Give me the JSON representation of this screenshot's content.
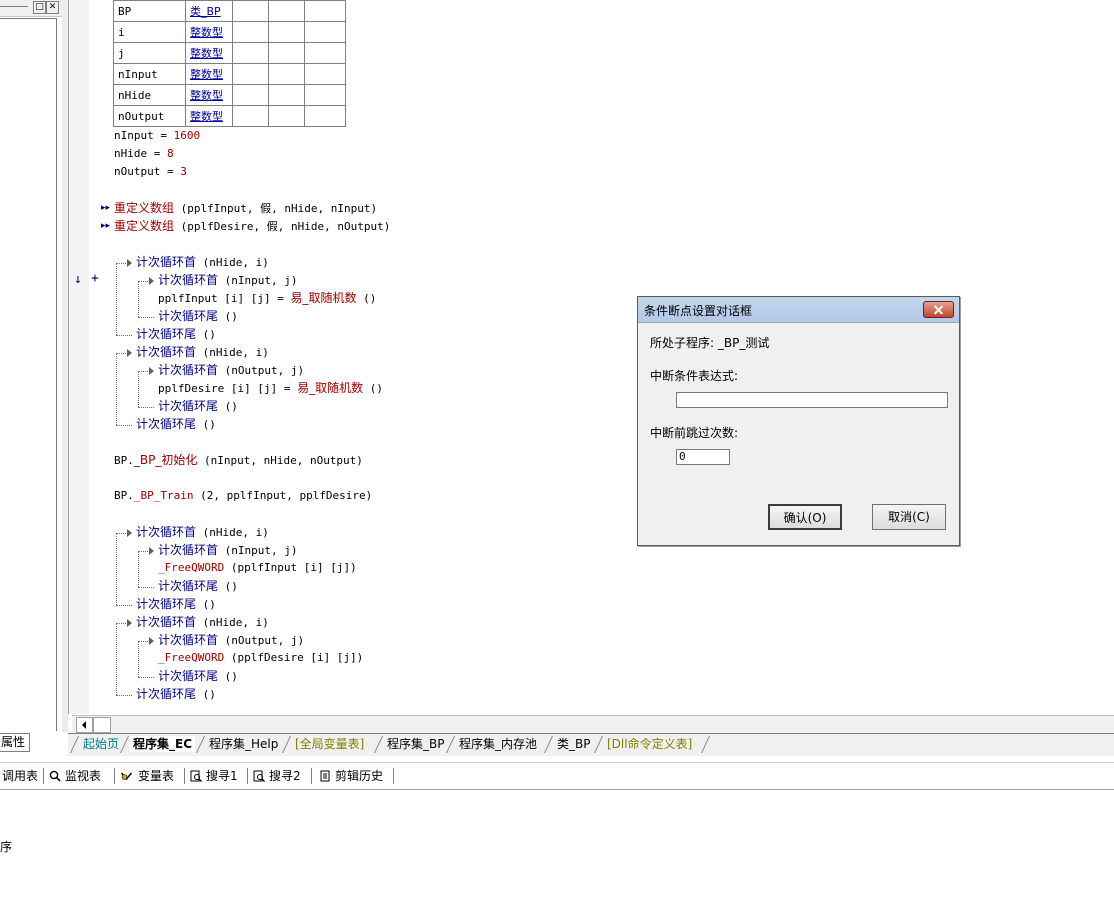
{
  "left_panel": {
    "restore_glyph": "□",
    "close_glyph": "✕",
    "attr_tab": "属性"
  },
  "var_table": [
    {
      "name": "BP",
      "type": "类_BP"
    },
    {
      "name": "i",
      "type": "整数型"
    },
    {
      "name": "j",
      "type": "整数型"
    },
    {
      "name": "nInput",
      "type": "整数型"
    },
    {
      "name": "nHide",
      "type": "整数型"
    },
    {
      "name": "nOutput",
      "type": "整数型"
    }
  ],
  "code": {
    "assign1": {
      "lhs": "nInput = ",
      "val": "1600"
    },
    "assign2": {
      "lhs": "nHide = ",
      "val": "8"
    },
    "assign3": {
      "lhs": "nOutput = ",
      "val": "3"
    },
    "redim1": {
      "fn": "重定义数组",
      "args": " (pplfInput, 假, nHide, nInput)"
    },
    "redim2": {
      "fn": "重定义数组",
      "args": " (pplfDesire, 假, nHide, nOutput)"
    },
    "loop_head": "计次循环首",
    "loop_tail": "计次循环尾",
    "args_nhide_i": " (nHide, i)",
    "args_ninput_j": " (nInput, j)",
    "args_noutput_j": " (nOutput, j)",
    "args_empty": " ()",
    "rand_fn": "易_取随机数",
    "assign_input": "pplfInput [i] [j] = ",
    "assign_desire": "pplfDesire [i] [j] = ",
    "bp_init_prefix": "BP.",
    "bp_init_fn": "_BP_初始化",
    "bp_init_args": " (nInput, nHide, nOutput)",
    "bp_train_prefix": "BP.",
    "bp_train_fn": "_BP_Train",
    "bp_train_args": " (2, pplfInput, pplfDesire)",
    "free_fn": "_FreeQWORD",
    "free_args_input": " (pplfInput [i] [j])",
    "free_args_desire": " (pplfDesire [i] [j])",
    "gutter_arrow": "↓",
    "gutter_plus": "+",
    "bullet": "▸▸"
  },
  "tabs": [
    {
      "label": "起始页",
      "color": "#008080"
    },
    {
      "label": "程序集_EC",
      "color": "#000000"
    },
    {
      "label": "程序集_Help",
      "color": "#000000"
    },
    {
      "label": "[全局变量表]",
      "color": "#808000"
    },
    {
      "label": "程序集_BP",
      "color": "#000000"
    },
    {
      "label": "程序集_内存池",
      "color": "#000000"
    },
    {
      "label": "类_BP",
      "color": "#000000"
    },
    {
      "label": "[Dll命令定义表]",
      "color": "#808000"
    }
  ],
  "toolbar": {
    "call_table": "调用表",
    "watch": "监视表",
    "vars": "变量表",
    "search1": "搜寻1",
    "search2": "搜寻2",
    "clip_history": "剪辑历史"
  },
  "output": {
    "text": "序"
  },
  "dialog": {
    "title": "条件断点设置对话框",
    "subprogram_label": "所处子程序: _BP_测试",
    "condition_label": "中断条件表达式:",
    "condition_value": "",
    "skip_label": "中断前跳过次数:",
    "skip_value": "0",
    "ok_label": "确认(O)",
    "cancel_label": "取消(C)"
  }
}
